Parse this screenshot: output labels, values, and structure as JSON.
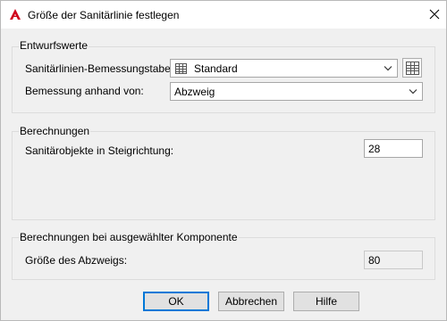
{
  "window": {
    "title": "Größe der Sanitärlinie festlegen",
    "close_icon": "close-icon",
    "app_icon": "autocad-a-icon",
    "accent_color": "#d0021b"
  },
  "design_group": {
    "title": "Entwurfswerte",
    "sizing_table_label": "Sanitärlinien-Bemessungstabelle:",
    "sizing_table_value": "Standard",
    "sizing_basis_label": "Bemessung anhand von:",
    "sizing_basis_value": "Abzweig"
  },
  "calculations_group": {
    "title": "Berechnungen",
    "fixture_units_label": "Sanitärobjekte in Steigrichtung:",
    "fixture_units_value": "28"
  },
  "selected_component_group": {
    "title": "Berechnungen bei ausgewählter Komponente",
    "branch_size_label": "Größe des Abzweigs:",
    "branch_size_value": "80"
  },
  "buttons": {
    "ok": "OK",
    "cancel": "Abbrechen",
    "help": "Hilfe"
  }
}
